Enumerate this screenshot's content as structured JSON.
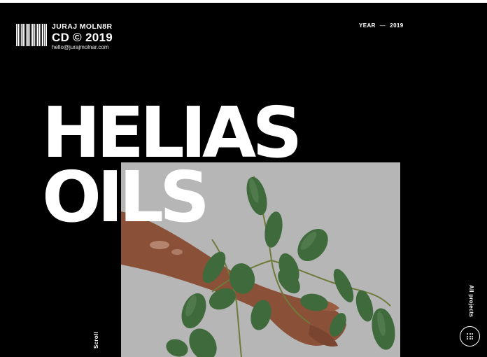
{
  "brand": {
    "name": "JURAJ MOLN8R",
    "cd": "CD © 2019",
    "email": "hello@jurajmolnar.com"
  },
  "meta": {
    "year_label": "YEAR",
    "separator": "—",
    "year_value": "2019"
  },
  "project": {
    "title_line1": "HELIAS",
    "title_line2": "OILS"
  },
  "nav": {
    "scroll_label": "Scroll",
    "all_projects_label": "All projects"
  },
  "icons": {
    "barcode": "barcode-icon",
    "projects_grid": "grid-dots-icon"
  },
  "colors": {
    "background": "#000000",
    "foreground": "#ffffff",
    "hero_backdrop": "#b6b6b6",
    "leaf": "#3f6a3c",
    "skin": "#8b5138"
  }
}
